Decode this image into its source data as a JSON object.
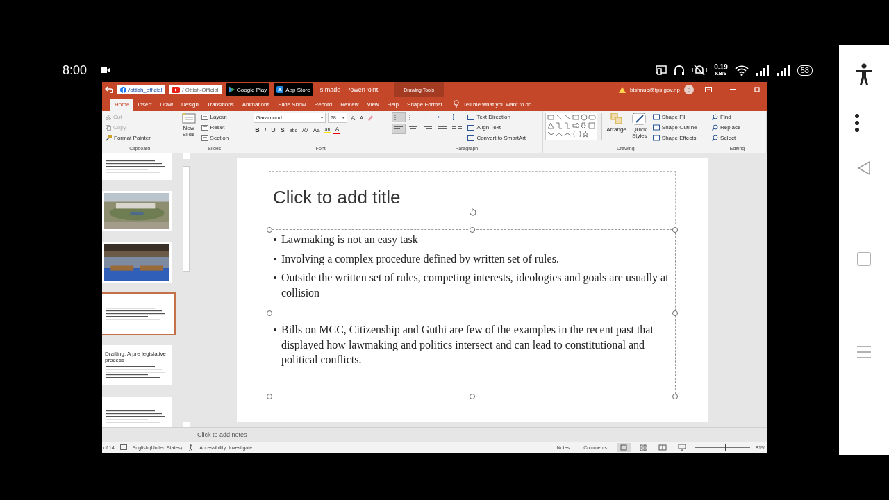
{
  "phone_status": {
    "time": "8:00",
    "net_speed": "0.19",
    "net_unit": "KB/S",
    "battery": "58"
  },
  "badges": [
    {
      "kind": "facebook",
      "label": "/ottish_official"
    },
    {
      "kind": "youtube",
      "label": "/ Ottish-Official"
    },
    {
      "kind": "play",
      "label": "Google Play"
    },
    {
      "kind": "appstore",
      "label": "App Store"
    }
  ],
  "window": {
    "title": "s made  -  PowerPoint",
    "context_tab_group": "Drawing Tools",
    "account": "bishnuc@fps.gov.np",
    "avatar": "B"
  },
  "tabs": [
    {
      "label": "Home",
      "selected": true
    },
    {
      "label": "Insert",
      "selected": false
    },
    {
      "label": "Draw",
      "selected": false
    },
    {
      "label": "Design",
      "selected": false
    },
    {
      "label": "Transitions",
      "selected": false
    },
    {
      "label": "Animations",
      "selected": false
    },
    {
      "label": "Slide Show",
      "selected": false
    },
    {
      "label": "Record",
      "selected": false
    },
    {
      "label": "Review",
      "selected": false
    },
    {
      "label": "View",
      "selected": false
    },
    {
      "label": "Help",
      "selected": false
    },
    {
      "label": "Shape Format",
      "selected": false
    }
  ],
  "tell_me": "Tell me what you want to do",
  "clipboard": {
    "label": "Clipboard",
    "items": [
      {
        "kind": "cut",
        "label": "Cut",
        "disabled": true
      },
      {
        "kind": "copy",
        "label": "Copy",
        "disabled": true
      },
      {
        "kind": "painter",
        "label": "Format Painter",
        "disabled": false
      }
    ]
  },
  "slides_group": {
    "label": "Slides",
    "new_slide": [
      "New",
      "Slide"
    ],
    "items": [
      "Layout",
      "Reset",
      "Section"
    ]
  },
  "font_group": {
    "label": "Font",
    "font_name": "Garamond",
    "font_size": "28",
    "grow": "A",
    "shrink": "A",
    "buttons": [
      {
        "kind": "bold",
        "label": "B"
      },
      {
        "kind": "italic",
        "label": "I"
      },
      {
        "kind": "underline",
        "label": "U"
      },
      {
        "kind": "shadow",
        "label": "S"
      },
      {
        "kind": "strike",
        "label": "abc"
      },
      {
        "kind": "spacing",
        "label": "AV"
      },
      {
        "kind": "case",
        "label": "Aa"
      }
    ],
    "highlight": "ab",
    "font_color": "A"
  },
  "paragraph_group": {
    "label": "Paragraph",
    "buttons": [
      {
        "kind": "bullets",
        "selected": true
      },
      {
        "kind": "numbering",
        "selected": false
      },
      {
        "kind": "outdent",
        "selected": false
      },
      {
        "kind": "indent",
        "selected": false
      },
      {
        "kind": "linespacing",
        "selected": false
      }
    ],
    "align_buttons": [
      {
        "kind": "left",
        "selected": true
      },
      {
        "kind": "center",
        "selected": false
      },
      {
        "kind": "right",
        "selected": false
      },
      {
        "kind": "justify",
        "selected": false
      },
      {
        "kind": "columns",
        "selected": false
      }
    ],
    "items": [
      "Text Direction",
      "Align Text",
      "Convert to SmartArt"
    ]
  },
  "drawing_group": {
    "label": "Drawing",
    "arrange": "Arrange",
    "quick_styles": [
      "Quick",
      "Styles"
    ],
    "items": [
      "Shape Fill",
      "Shape Outline",
      "Shape Effects"
    ]
  },
  "editing_group": {
    "label": "Editing",
    "items": [
      "Find",
      "Replace",
      "Select"
    ]
  },
  "thumbnails": [
    {
      "kind": "text",
      "selected": false
    },
    {
      "kind": "picture",
      "selected": false
    },
    {
      "kind": "picture",
      "selected": false
    },
    {
      "kind": "text",
      "selected": true
    },
    {
      "kind": "titled",
      "title": "Drafting: A pre legislative process",
      "selected": false
    },
    {
      "kind": "text",
      "selected": false
    }
  ],
  "slide": {
    "title_placeholder": "Click to add title",
    "bullets": [
      {
        "text": "Lawmaking is not an easy task",
        "gap_before": false
      },
      {
        "text": "Involving a complex procedure defined by written set of rules.",
        "gap_before": false
      },
      {
        "text": "Outside the written set of rules, competing interests, ideologies and goals are usually at collision",
        "gap_before": false
      },
      {
        "text": "Bills on MCC, Citizenship and Guthi are few of the examples in the recent past that displayed how lawmaking and politics intersect and can lead to constitutional and political conflicts.",
        "gap_before": true
      }
    ]
  },
  "notes_placeholder": "Click to add notes",
  "status_bar": {
    "slide_count": "of 14",
    "language": "English (United States)",
    "accessibility": "Accessibility: Investigate",
    "notes": "Notes",
    "comments": "Comments",
    "zoom": "81%",
    "zoom_slider": {
      "level": 0.55
    }
  }
}
